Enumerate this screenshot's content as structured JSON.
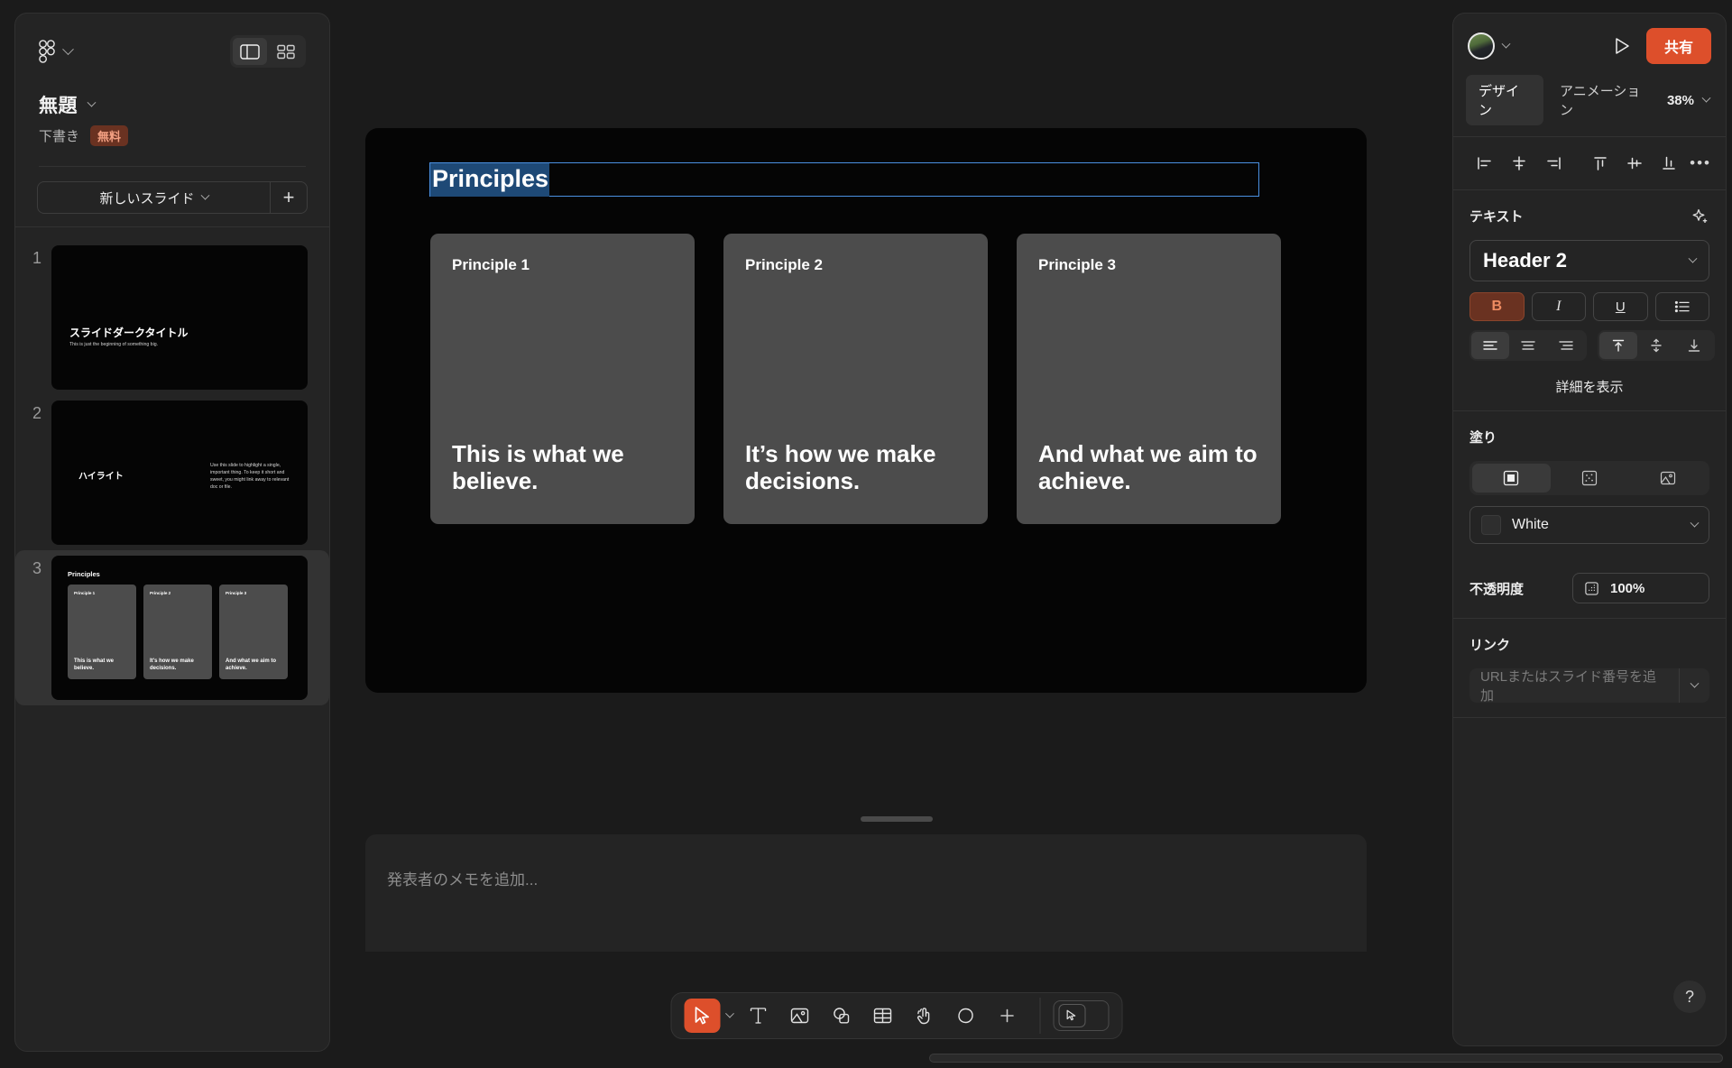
{
  "app": {
    "logo_icon": "figma-slides-logo",
    "doc_title": "無題",
    "doc_status": "下書き",
    "plan_badge": "無料",
    "view_panel_icon": "panel-layout-icon",
    "view_grid_icon": "grid-layout-icon"
  },
  "sidebar": {
    "new_slide_label": "新しいスライド",
    "add_slide_icon": "plus-icon",
    "slides": [
      {
        "number": "1",
        "title": "スライドダークタイトル",
        "subtitle": "This is just the beginning of something big.",
        "selected": false
      },
      {
        "number": "2",
        "title": "ハイライト",
        "body": "Use this slide to highlight a single, important thing. To keep it short and sweet, you might link away to relevant doc or file.",
        "selected": false
      },
      {
        "number": "3",
        "title": "Principles",
        "selected": true,
        "cards": [
          {
            "head": "Principle 1",
            "body": "This is what we believe."
          },
          {
            "head": "Principle 2",
            "body": "It's how we make decisions."
          },
          {
            "head": "Principle 3",
            "body": "And what we aim to achieve."
          }
        ]
      }
    ]
  },
  "slide": {
    "title": "Principles",
    "title_selected": true,
    "cards": [
      {
        "head": "Principle 1",
        "body": "This is what we believe."
      },
      {
        "head": "Principle 2",
        "body": "It’s how we make decisions."
      },
      {
        "head": "Principle 3",
        "body": "And what we aim to achieve."
      }
    ]
  },
  "notes": {
    "placeholder": "発表者のメモを追加..."
  },
  "toolbar": {
    "tools": [
      {
        "name": "select-tool",
        "icon": "cursor-icon",
        "active": true
      },
      {
        "name": "text-tool",
        "icon": "text-icon",
        "active": false
      },
      {
        "name": "image-tool",
        "icon": "image-icon",
        "active": false
      },
      {
        "name": "shape-tool",
        "icon": "shapes-icon",
        "active": false
      },
      {
        "name": "table-tool",
        "icon": "table-icon",
        "active": false
      },
      {
        "name": "interaction-tool",
        "icon": "tap-hand-icon",
        "active": false
      },
      {
        "name": "comment-tool",
        "icon": "comment-bubble-icon",
        "active": false
      },
      {
        "name": "add-tool",
        "icon": "plus-icon",
        "active": false
      }
    ],
    "pen_toggle_icon": "pen-toggle-icon"
  },
  "right_panel": {
    "avatar_icon": "user-avatar",
    "present_icon": "play-icon",
    "share_label": "共有",
    "tabs": [
      {
        "label": "デザイン",
        "active": true
      },
      {
        "label": "アニメーション",
        "active": false
      }
    ],
    "zoom_level": "38%",
    "align_buttons": [
      {
        "name": "align-left-icon"
      },
      {
        "name": "align-horizontal-center-icon"
      },
      {
        "name": "align-right-icon"
      },
      {
        "name": "align-top-icon"
      },
      {
        "name": "align-vertical-center-icon"
      },
      {
        "name": "align-bottom-icon"
      }
    ],
    "more_label": "•••",
    "text_section": {
      "title": "テキスト",
      "ai_icon": "sparkle-icon",
      "style": "Header 2",
      "bold_label": "B",
      "italic_label": "I",
      "underline_label": "U",
      "list_icon": "bullet-list-icon",
      "bold_active": true,
      "show_more": "詳細を表示"
    },
    "fill_section": {
      "title": "塗り",
      "types": [
        {
          "name": "solid-fill-icon",
          "active": true
        },
        {
          "name": "pattern-fill-icon",
          "active": false
        },
        {
          "name": "image-fill-icon",
          "active": false
        }
      ],
      "color_name": "White"
    },
    "opacity_section": {
      "label": "不透明度",
      "value": "100%",
      "icon": "opacity-grid-icon"
    },
    "link_section": {
      "title": "リンク",
      "placeholder": "URLまたはスライド番号を追加"
    },
    "help_label": "?"
  }
}
